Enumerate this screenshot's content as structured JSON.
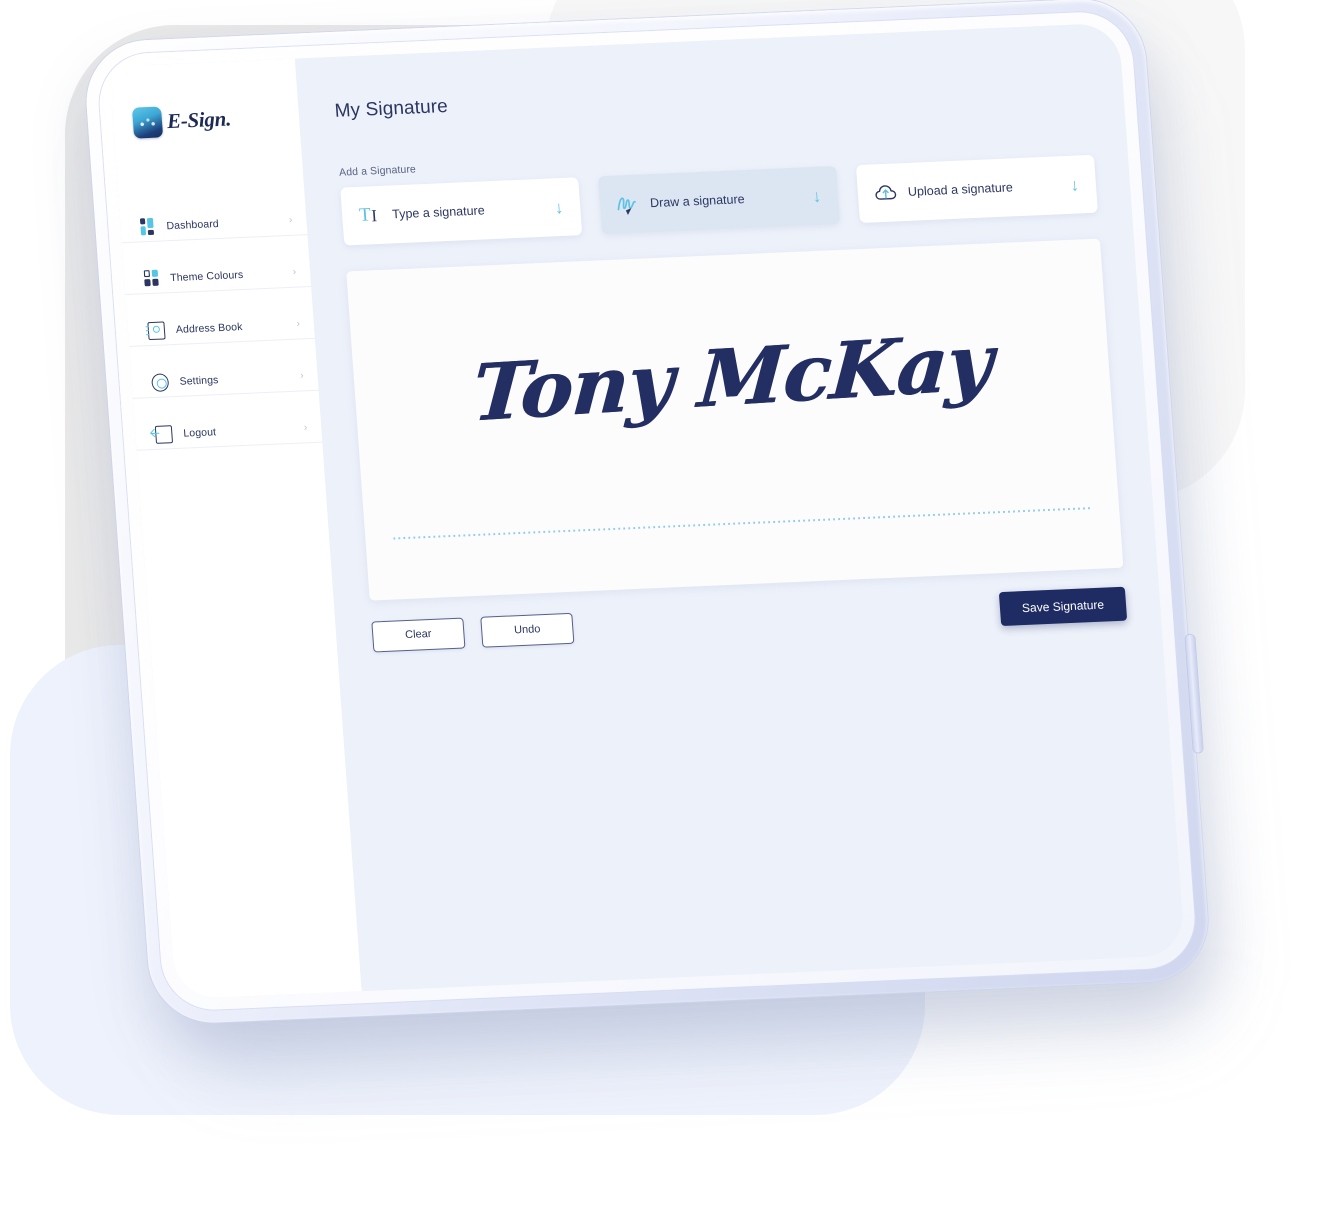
{
  "brand": {
    "name": "E-Sign.",
    "mark_icon": "esign-logo-icon"
  },
  "sidebar": {
    "items": [
      {
        "label": "Dashboard",
        "icon": "dashboard-icon",
        "chevron": "›"
      },
      {
        "label": "Theme Colours",
        "icon": "palette-icon",
        "chevron": "›"
      },
      {
        "label": "Address Book",
        "icon": "address-book-icon",
        "chevron": "›"
      },
      {
        "label": "Settings",
        "icon": "gear-icon",
        "chevron": "›"
      },
      {
        "label": "Logout",
        "icon": "logout-icon",
        "chevron": "›"
      }
    ]
  },
  "main": {
    "page_title": "My Signature",
    "add_label": "Add a Signature",
    "options": [
      {
        "label": "Type a signature",
        "icon": "text-cursor-icon",
        "arrow": "↓",
        "selected": false
      },
      {
        "label": "Draw a signature",
        "icon": "pen-squiggle-icon",
        "arrow": "↓",
        "selected": true
      },
      {
        "label": "Upload a signature",
        "icon": "cloud-upload-icon",
        "arrow": "↓",
        "selected": false
      }
    ],
    "signature_value": "Tony McKay",
    "buttons": {
      "clear": "Clear",
      "undo": "Undo",
      "save": "Save Signature"
    }
  },
  "colors": {
    "navy": "#1f2b63",
    "accent_blue": "#5fc2e4",
    "selected_card": "#dbe6f2",
    "content_bg": "#edf1fa",
    "signature_ink": "#232f63",
    "dotted_line": "#79c4e8"
  }
}
